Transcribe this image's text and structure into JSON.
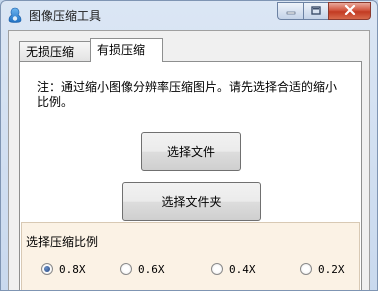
{
  "window": {
    "title": "图像压缩工具",
    "colors": {
      "titlebar": "#c9d9ee",
      "close": "#c23b22",
      "group_bg": "#fbf2e5"
    }
  },
  "tabs": [
    {
      "label": "无损压缩",
      "selected": false
    },
    {
      "label": "有损压缩",
      "selected": true
    }
  ],
  "panel": {
    "note": "注：通过缩小图像分辨率压缩图片。请先选择合适的缩小比例。",
    "select_file_label": "选择文件",
    "select_folder_label": "选择文件夹",
    "ratio_group": {
      "label": "选择压缩比例",
      "options": [
        {
          "label": "0.8X",
          "checked": true
        },
        {
          "label": "0.6X",
          "checked": false
        },
        {
          "label": "0.4X",
          "checked": false
        },
        {
          "label": "0.2X",
          "checked": false
        }
      ]
    }
  },
  "icons": {
    "app": "app-icon",
    "minimize": "minimize-icon",
    "maximize": "maximize-icon",
    "close": "close-icon"
  }
}
